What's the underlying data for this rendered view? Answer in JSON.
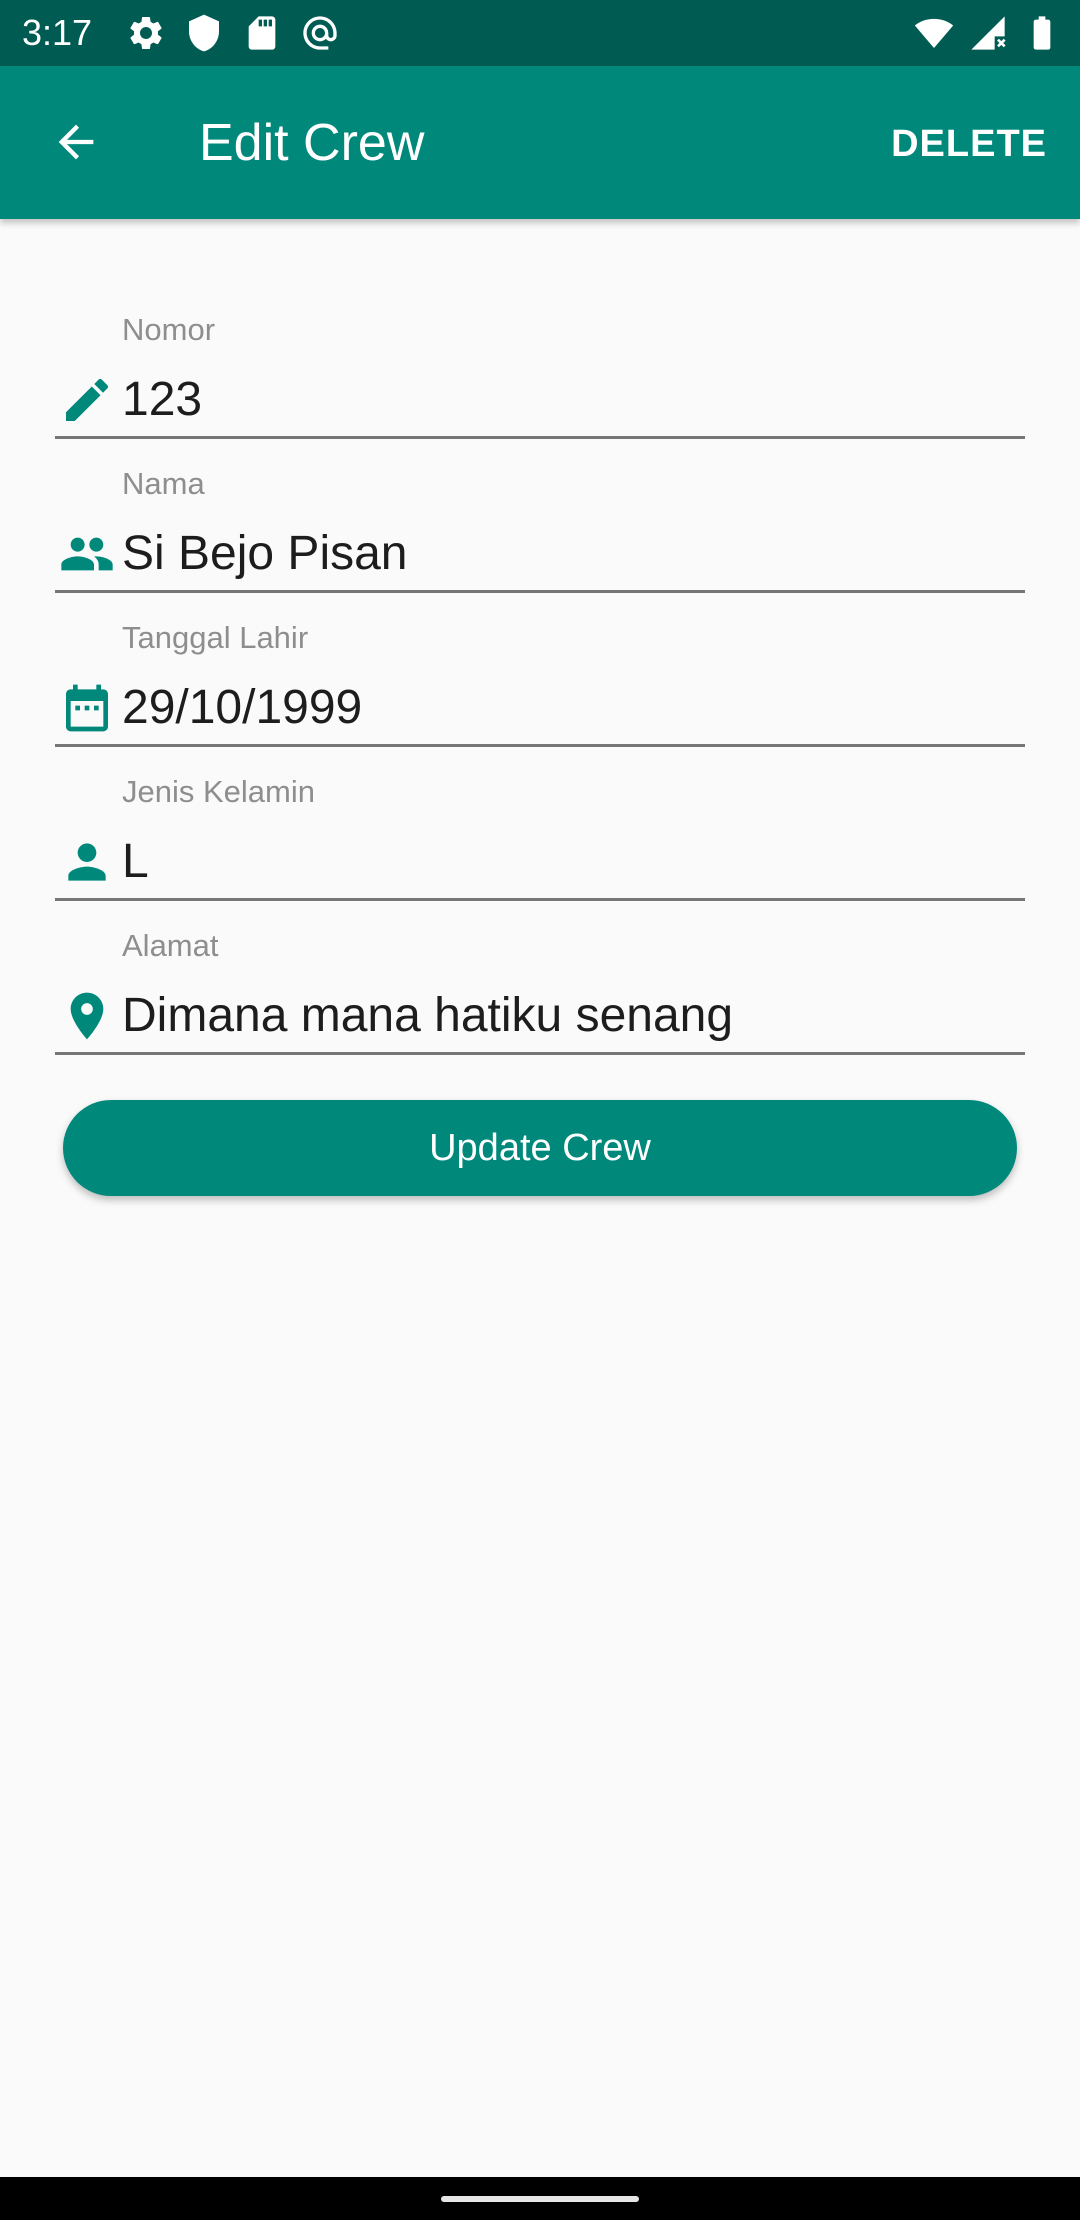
{
  "status_bar": {
    "time": "3:17",
    "left_icons": [
      "settings-icon",
      "shield-icon",
      "sd-card-icon",
      "at-sign-icon"
    ],
    "right_icons": [
      "wifi-icon",
      "signal-icon",
      "battery-icon"
    ]
  },
  "app_bar": {
    "back_icon": "arrow-back-icon",
    "title": "Edit Crew",
    "delete_label": "DELETE"
  },
  "form": {
    "fields": [
      {
        "label": "Nomor",
        "value": "123",
        "icon": "pencil-icon"
      },
      {
        "label": "Nama",
        "value": "Si Bejo Pisan",
        "icon": "group-icon"
      },
      {
        "label": "Tanggal Lahir",
        "value": "29/10/1999",
        "icon": "calendar-icon"
      },
      {
        "label": "Jenis Kelamin",
        "value": "L",
        "icon": "person-icon"
      },
      {
        "label": "Alamat",
        "value": "Dimana mana hatiku senang",
        "icon": "location-pin-icon"
      }
    ],
    "submit_label": "Update Crew"
  },
  "colors": {
    "primary": "#00897b",
    "primary_dark": "#005c52",
    "background": "#fafafa",
    "label": "#8e8e8e",
    "text": "#1d1d1d"
  }
}
